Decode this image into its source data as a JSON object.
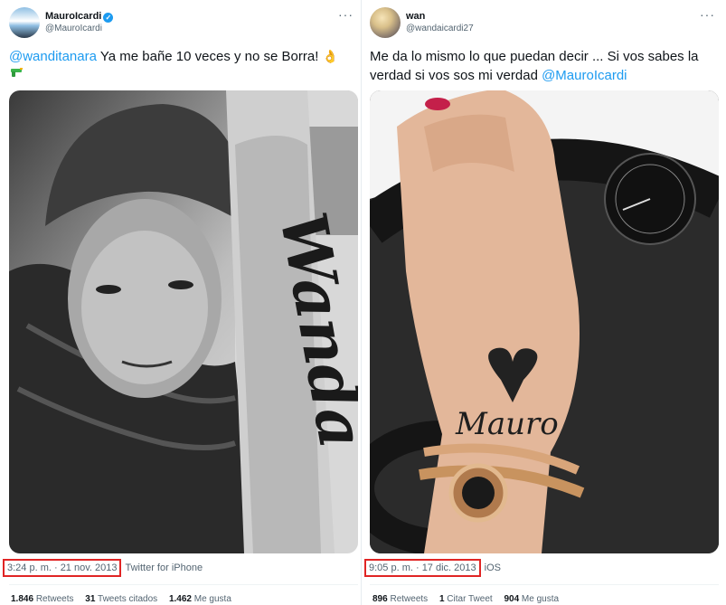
{
  "tweets": [
    {
      "name": "MauroIcardi",
      "handle": "@MauroIcardi",
      "verified": true,
      "mention": "@wanditanara",
      "text": " Ya me bañe 10 veces y no se Borra! ",
      "date": "3:24 p. m. · 21 nov. 2013",
      "source": "Twitter for iPhone",
      "stats": [
        {
          "num": "1.846",
          "label": "Retweets"
        },
        {
          "num": "31",
          "label": "Tweets citados"
        },
        {
          "num": "1.462",
          "label": "Me gusta"
        }
      ]
    },
    {
      "name": "wan",
      "handle": "@wandaicardi27",
      "verified": false,
      "text": "Me da lo mismo lo que puedan decir ... Si vos sabes la verdad si vos sos mi verdad ",
      "mention": "@MauroIcardi",
      "date": "9:05 p. m. · 17 dic. 2013",
      "source": "iOS",
      "stats": [
        {
          "num": "896",
          "label": "Retweets"
        },
        {
          "num": "1",
          "label": "Citar Tweet"
        },
        {
          "num": "904",
          "label": "Me gusta"
        }
      ]
    }
  ],
  "icons": {
    "more": "···",
    "verified": "✓",
    "ok_hand": "👌"
  },
  "photos": {
    "left_tattoo_text": "Wanda",
    "right_tattoo_text": "Mauro"
  }
}
